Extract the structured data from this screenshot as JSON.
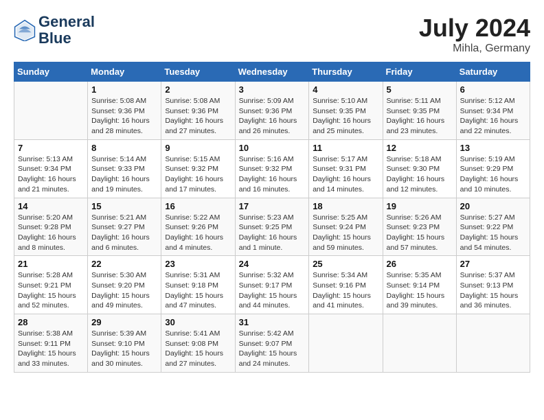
{
  "header": {
    "logo_line1": "General",
    "logo_line2": "Blue",
    "month": "July 2024",
    "location": "Mihla, Germany"
  },
  "weekdays": [
    "Sunday",
    "Monday",
    "Tuesday",
    "Wednesday",
    "Thursday",
    "Friday",
    "Saturday"
  ],
  "weeks": [
    [
      {
        "day": "",
        "info": ""
      },
      {
        "day": "1",
        "info": "Sunrise: 5:08 AM\nSunset: 9:36 PM\nDaylight: 16 hours\nand 28 minutes."
      },
      {
        "day": "2",
        "info": "Sunrise: 5:08 AM\nSunset: 9:36 PM\nDaylight: 16 hours\nand 27 minutes."
      },
      {
        "day": "3",
        "info": "Sunrise: 5:09 AM\nSunset: 9:36 PM\nDaylight: 16 hours\nand 26 minutes."
      },
      {
        "day": "4",
        "info": "Sunrise: 5:10 AM\nSunset: 9:35 PM\nDaylight: 16 hours\nand 25 minutes."
      },
      {
        "day": "5",
        "info": "Sunrise: 5:11 AM\nSunset: 9:35 PM\nDaylight: 16 hours\nand 23 minutes."
      },
      {
        "day": "6",
        "info": "Sunrise: 5:12 AM\nSunset: 9:34 PM\nDaylight: 16 hours\nand 22 minutes."
      }
    ],
    [
      {
        "day": "7",
        "info": "Sunrise: 5:13 AM\nSunset: 9:34 PM\nDaylight: 16 hours\nand 21 minutes."
      },
      {
        "day": "8",
        "info": "Sunrise: 5:14 AM\nSunset: 9:33 PM\nDaylight: 16 hours\nand 19 minutes."
      },
      {
        "day": "9",
        "info": "Sunrise: 5:15 AM\nSunset: 9:32 PM\nDaylight: 16 hours\nand 17 minutes."
      },
      {
        "day": "10",
        "info": "Sunrise: 5:16 AM\nSunset: 9:32 PM\nDaylight: 16 hours\nand 16 minutes."
      },
      {
        "day": "11",
        "info": "Sunrise: 5:17 AM\nSunset: 9:31 PM\nDaylight: 16 hours\nand 14 minutes."
      },
      {
        "day": "12",
        "info": "Sunrise: 5:18 AM\nSunset: 9:30 PM\nDaylight: 16 hours\nand 12 minutes."
      },
      {
        "day": "13",
        "info": "Sunrise: 5:19 AM\nSunset: 9:29 PM\nDaylight: 16 hours\nand 10 minutes."
      }
    ],
    [
      {
        "day": "14",
        "info": "Sunrise: 5:20 AM\nSunset: 9:28 PM\nDaylight: 16 hours\nand 8 minutes."
      },
      {
        "day": "15",
        "info": "Sunrise: 5:21 AM\nSunset: 9:27 PM\nDaylight: 16 hours\nand 6 minutes."
      },
      {
        "day": "16",
        "info": "Sunrise: 5:22 AM\nSunset: 9:26 PM\nDaylight: 16 hours\nand 4 minutes."
      },
      {
        "day": "17",
        "info": "Sunrise: 5:23 AM\nSunset: 9:25 PM\nDaylight: 16 hours\nand 1 minute."
      },
      {
        "day": "18",
        "info": "Sunrise: 5:25 AM\nSunset: 9:24 PM\nDaylight: 15 hours\nand 59 minutes."
      },
      {
        "day": "19",
        "info": "Sunrise: 5:26 AM\nSunset: 9:23 PM\nDaylight: 15 hours\nand 57 minutes."
      },
      {
        "day": "20",
        "info": "Sunrise: 5:27 AM\nSunset: 9:22 PM\nDaylight: 15 hours\nand 54 minutes."
      }
    ],
    [
      {
        "day": "21",
        "info": "Sunrise: 5:28 AM\nSunset: 9:21 PM\nDaylight: 15 hours\nand 52 minutes."
      },
      {
        "day": "22",
        "info": "Sunrise: 5:30 AM\nSunset: 9:20 PM\nDaylight: 15 hours\nand 49 minutes."
      },
      {
        "day": "23",
        "info": "Sunrise: 5:31 AM\nSunset: 9:18 PM\nDaylight: 15 hours\nand 47 minutes."
      },
      {
        "day": "24",
        "info": "Sunrise: 5:32 AM\nSunset: 9:17 PM\nDaylight: 15 hours\nand 44 minutes."
      },
      {
        "day": "25",
        "info": "Sunrise: 5:34 AM\nSunset: 9:16 PM\nDaylight: 15 hours\nand 41 minutes."
      },
      {
        "day": "26",
        "info": "Sunrise: 5:35 AM\nSunset: 9:14 PM\nDaylight: 15 hours\nand 39 minutes."
      },
      {
        "day": "27",
        "info": "Sunrise: 5:37 AM\nSunset: 9:13 PM\nDaylight: 15 hours\nand 36 minutes."
      }
    ],
    [
      {
        "day": "28",
        "info": "Sunrise: 5:38 AM\nSunset: 9:11 PM\nDaylight: 15 hours\nand 33 minutes."
      },
      {
        "day": "29",
        "info": "Sunrise: 5:39 AM\nSunset: 9:10 PM\nDaylight: 15 hours\nand 30 minutes."
      },
      {
        "day": "30",
        "info": "Sunrise: 5:41 AM\nSunset: 9:08 PM\nDaylight: 15 hours\nand 27 minutes."
      },
      {
        "day": "31",
        "info": "Sunrise: 5:42 AM\nSunset: 9:07 PM\nDaylight: 15 hours\nand 24 minutes."
      },
      {
        "day": "",
        "info": ""
      },
      {
        "day": "",
        "info": ""
      },
      {
        "day": "",
        "info": ""
      }
    ]
  ]
}
